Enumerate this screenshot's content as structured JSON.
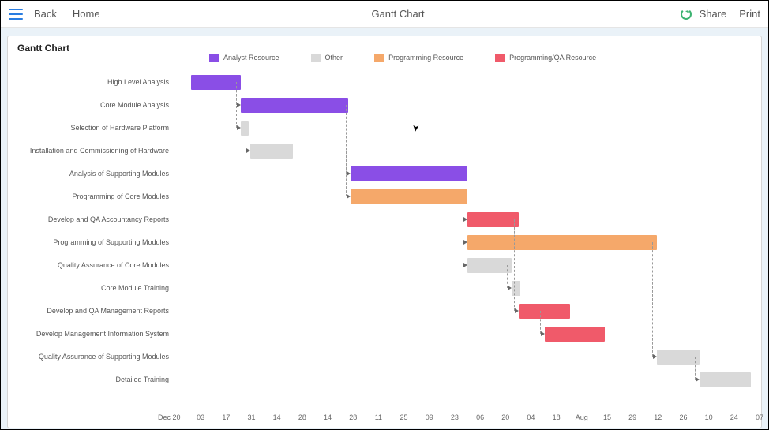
{
  "topbar": {
    "back": "Back",
    "home": "Home",
    "title": "Gantt Chart",
    "share": "Share",
    "print": "Print"
  },
  "card_title": "Gantt Chart",
  "legend": [
    {
      "label": "Analyst Resource",
      "color": "#8a4ee6"
    },
    {
      "label": "Other",
      "color": "#d9d9d9"
    },
    {
      "label": "Programming Resource",
      "color": "#f5a86a"
    },
    {
      "label": "Programming/QA Resource",
      "color": "#f05a6a"
    }
  ],
  "chart_data": {
    "type": "gantt",
    "title": "Gantt Chart",
    "x_axis": {
      "start": "Dec 20",
      "end": "07",
      "ticks_raw": [
        "Dec 20",
        "03",
        "17",
        "31",
        "14",
        "28",
        "14",
        "28",
        "11",
        "25",
        "09",
        "23",
        "06",
        "20",
        "04",
        "18",
        "Aug",
        "15",
        "29",
        "12",
        "26",
        "10",
        "24",
        "07"
      ]
    },
    "categories": [
      "Analyst Resource",
      "Other",
      "Programming Resource",
      "Programming/QA Resource"
    ],
    "tasks": [
      {
        "name": "High Level Analysis",
        "resource": "Analyst Resource",
        "start": 0.027,
        "end": 0.112
      },
      {
        "name": "Core Module Analysis",
        "resource": "Analyst Resource",
        "start": 0.112,
        "end": 0.296
      },
      {
        "name": "Selection of Hardware Platform",
        "resource": "Other",
        "start": 0.112,
        "end": 0.126
      },
      {
        "name": "Installation and Commissioning of Hardware",
        "resource": "Other",
        "start": 0.128,
        "end": 0.202
      },
      {
        "name": "Analysis of Supporting Modules",
        "resource": "Analyst Resource",
        "start": 0.3,
        "end": 0.5
      },
      {
        "name": "Programming of Core Modules",
        "resource": "Programming Resource",
        "start": 0.3,
        "end": 0.5
      },
      {
        "name": "Develop and QA Accountancy Reports",
        "resource": "Programming/QA Resource",
        "start": 0.5,
        "end": 0.588
      },
      {
        "name": "Programming of Supporting Modules",
        "resource": "Programming Resource",
        "start": 0.5,
        "end": 0.824
      },
      {
        "name": "Quality Assurance of Core Modules",
        "resource": "Other",
        "start": 0.5,
        "end": 0.575
      },
      {
        "name": "Core Module Training",
        "resource": "Other",
        "start": 0.575,
        "end": 0.59
      },
      {
        "name": "Develop and QA Management Reports",
        "resource": "Programming/QA Resource",
        "start": 0.588,
        "end": 0.676
      },
      {
        "name": "Develop Management Information System",
        "resource": "Programming/QA Resource",
        "start": 0.632,
        "end": 0.735
      },
      {
        "name": "Quality Assurance of Supporting Modules",
        "resource": "Other",
        "start": 0.824,
        "end": 0.897
      },
      {
        "name": "Detailed Training",
        "resource": "Other",
        "start": 0.897,
        "end": 0.985
      }
    ],
    "dependencies": [
      {
        "from": 0,
        "to": 1
      },
      {
        "from": 0,
        "to": 2
      },
      {
        "from": 2,
        "to": 3
      },
      {
        "from": 1,
        "to": 4
      },
      {
        "from": 1,
        "to": 5
      },
      {
        "from": 5,
        "to": 6
      },
      {
        "from": 4,
        "to": 7
      },
      {
        "from": 5,
        "to": 8
      },
      {
        "from": 8,
        "to": 9
      },
      {
        "from": 6,
        "to": 10
      },
      {
        "from": 10,
        "to": 11
      },
      {
        "from": 7,
        "to": 12
      },
      {
        "from": 12,
        "to": 13
      }
    ]
  }
}
